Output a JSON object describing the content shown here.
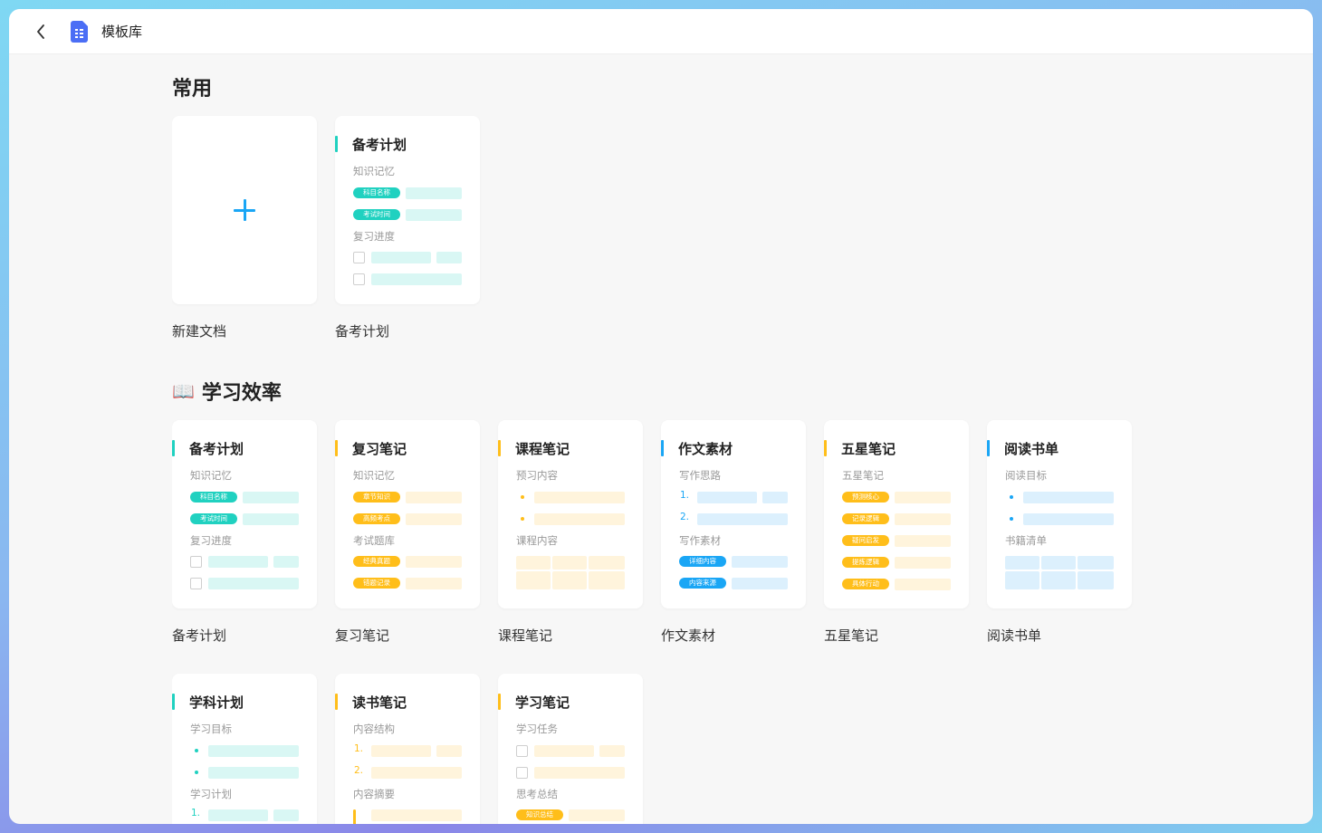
{
  "window": {
    "title": "模板库"
  },
  "sections": {
    "common": {
      "title": "常用"
    },
    "study": {
      "icon": "📖",
      "title": "学习效率"
    }
  },
  "new_doc": {
    "label": "新建文档"
  },
  "colors": {
    "teal": "#20d1c0",
    "teal_light": "#d9f7f4",
    "orange": "#ffbe1a",
    "orange_light": "#fff4dc",
    "blue": "#1aa6f5",
    "blue_light": "#dcf0fd",
    "accent_plus": "#1aa6f5"
  },
  "cards": {
    "common_exam": {
      "label": "备考计划",
      "title": "备考计划",
      "s1": "知识记忆",
      "p1": "科目名称",
      "p2": "考试时间",
      "s2": "复习进度"
    },
    "exam": {
      "label": "备考计划",
      "title": "备考计划",
      "s1": "知识记忆",
      "p1": "科目名称",
      "p2": "考试时间",
      "s2": "复习进度"
    },
    "review": {
      "label": "复习笔记",
      "title": "复习笔记",
      "s1": "知识记忆",
      "p1": "章节知识",
      "p2": "高频考点",
      "s2": "考试题库",
      "p3": "经典真题",
      "p4": "错题记录"
    },
    "course": {
      "label": "课程笔记",
      "title": "课程笔记",
      "s1": "预习内容",
      "s2": "课程内容"
    },
    "essay": {
      "label": "作文素材",
      "title": "作文素材",
      "s1": "写作思路",
      "n1": "1.",
      "n2": "2.",
      "s2": "写作素材",
      "p1": "详细内容",
      "p2": "内容来源"
    },
    "fivestar": {
      "label": "五星笔记",
      "title": "五星笔记",
      "s1": "五星笔记",
      "p1": "预测核心",
      "p2": "记录逻辑",
      "p3": "疑问启发",
      "p4": "提炼逻辑",
      "p5": "具体行动"
    },
    "reading": {
      "label": "阅读书单",
      "title": "阅读书单",
      "s1": "阅读目标",
      "s2": "书籍清单"
    },
    "subject": {
      "label": "学科计划",
      "title": "学科计划",
      "s1": "学习目标",
      "s2": "学习计划",
      "n1": "1."
    },
    "book": {
      "label": "读书笔记",
      "title": "读书笔记",
      "s1": "内容结构",
      "n1": "1.",
      "n2": "2.",
      "s2": "内容摘要"
    },
    "studynote": {
      "label": "学习笔记",
      "title": "学习笔记",
      "s1": "学习任务",
      "s2": "思考总结",
      "p1": "知识总结"
    }
  }
}
